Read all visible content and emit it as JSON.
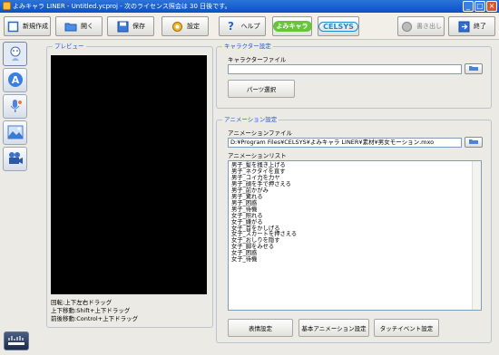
{
  "window": {
    "title": "よみキャラ LINER - Untitled.ycproj - 次のライセンス照会は 30 日後です。"
  },
  "toolbar": {
    "new": "新規作成",
    "open": "開く",
    "save": "保存",
    "settings": "設定",
    "help": "ヘルプ",
    "export": "書き出し",
    "exit": "終了",
    "logo1": "よみキャラ",
    "logo2": "CELSYS"
  },
  "preview": {
    "title": "プレビュー",
    "hints": [
      "回転:上下左右ドラッグ",
      "上下移動:Shift+上下ドラッグ",
      "前後移動:Control+上下ドラッグ"
    ]
  },
  "character": {
    "title": "キャラクター設定",
    "file_label": "キャラクターファイル",
    "file_value": "",
    "parts_button": "パーツ選択"
  },
  "animation": {
    "title": "アニメーション設定",
    "file_label": "アニメーションファイル",
    "file_value": "D:¥Program Files¥CELSYS¥よみキャラ LINER¥素材¥男女モーション.mxo",
    "list_label": "アニメーションリスト",
    "list": [
      "男子_髪を掻き上げる",
      "男子_ネクタイを直す",
      "男子_コイ力を力ヤ",
      "男子_顔を手で押さえる",
      "男子_前かがみ",
      "男子_驚れる",
      "男子_困惑",
      "男子_待機",
      "女子_照れる",
      "女子_嫌がる",
      "女子_首をかしげる",
      "女子_スカートを押さえる",
      "女子_おしりを隠す",
      "女子_脚をみせる",
      "女子_困惑",
      "女子_待機"
    ],
    "buttons": {
      "expression": "表情設定",
      "basic": "基本アニメーション設定",
      "touch": "タッチイベント設定"
    }
  },
  "colors": {
    "group_title": "#2255cc",
    "title_bar": "#0a52c4",
    "preview_bg": "#000000"
  }
}
